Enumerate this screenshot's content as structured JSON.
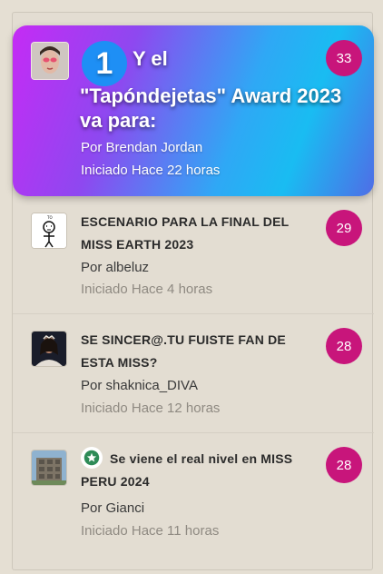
{
  "featured": {
    "rank": "1",
    "title_line1": "Y el",
    "title_line2": "\"Tapóndejetas\" Award 2023 va para:",
    "author": "Por Brendan Jordan",
    "started": "Iniciado Hace 22 horas",
    "count": "33",
    "avatar_icon": "face-photo"
  },
  "topics": [
    {
      "title": "ESCENARIO PARA LA FINAL DEL MISS EARTH 2023",
      "author": "Por albeluz",
      "started": "Iniciado Hace 4 horas",
      "count": "29",
      "thumb_icon": "stick-figure-meme"
    },
    {
      "title": "SE SINCER@.TU FUISTE FAN DE ESTA MISS?",
      "author": "Por shaknica_DIVA",
      "started": "Iniciado Hace 12 horas",
      "count": "28",
      "thumb_icon": "pageant-photo"
    },
    {
      "title": "Se viene el real nivel en MISS PERU 2024",
      "author": "Por Gianci",
      "started": "Iniciado Hace 11 horas",
      "count": "28",
      "thumb_icon": "building-photo",
      "pinned_icon": "star-icon"
    }
  ],
  "colors": {
    "badge": "#c8157b",
    "rank_circle": "#1e8ff5",
    "pin_star": "#2e8b57"
  }
}
